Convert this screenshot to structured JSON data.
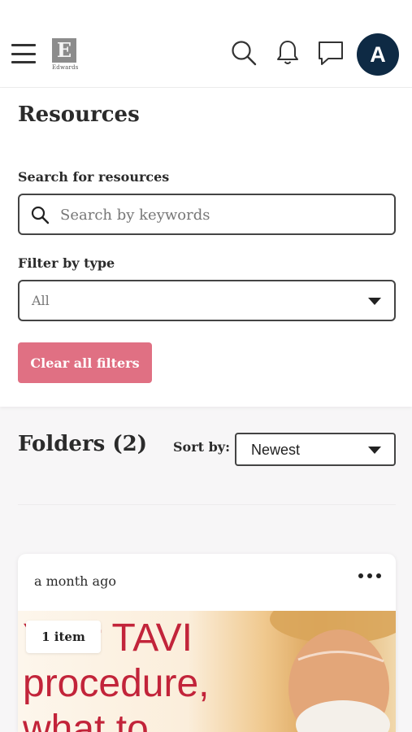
{
  "header": {
    "logo_letter": "E",
    "logo_text": "Edwards",
    "avatar_initial": "A"
  },
  "page": {
    "title": "Resources"
  },
  "search": {
    "label": "Search for resources",
    "placeholder": "Search by keywords"
  },
  "filter": {
    "label": "Filter by type",
    "selected": "All"
  },
  "clear_button": {
    "label": "Clear all filters"
  },
  "folders": {
    "title": "Folders (2)",
    "sort_label": "Sort by:",
    "sort_selected": "Newest"
  },
  "card": {
    "date": "a month ago",
    "badge": "1 item",
    "image_text": "Your TAVI\nprocedure,\nwhat to"
  },
  "colors": {
    "accent_pink": "#e07083",
    "avatar_navy": "#0e2a44",
    "image_red": "#c2243a"
  },
  "icons": [
    "menu-icon",
    "edwards-logo",
    "search-icon",
    "bell-icon",
    "chat-icon",
    "magnifier-icon",
    "caret-down-icon",
    "more-options-icon"
  ]
}
